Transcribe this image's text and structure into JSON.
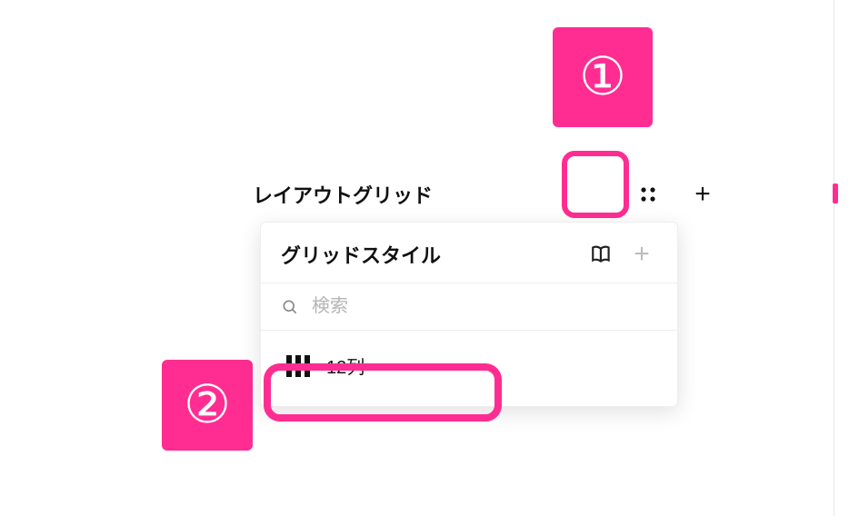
{
  "annotations": {
    "one": "①",
    "two": "②"
  },
  "layout_grid": {
    "title": "レイアウトグリッド",
    "styles_button_title": "グリッドスタイル",
    "add_button_label": "+"
  },
  "panel": {
    "title": "グリッドスタイル",
    "library_icon": "library-icon",
    "add_icon": "plus-icon",
    "search_placeholder": "検索",
    "items": [
      {
        "icon": "columns-icon",
        "label": "12列"
      }
    ]
  }
}
